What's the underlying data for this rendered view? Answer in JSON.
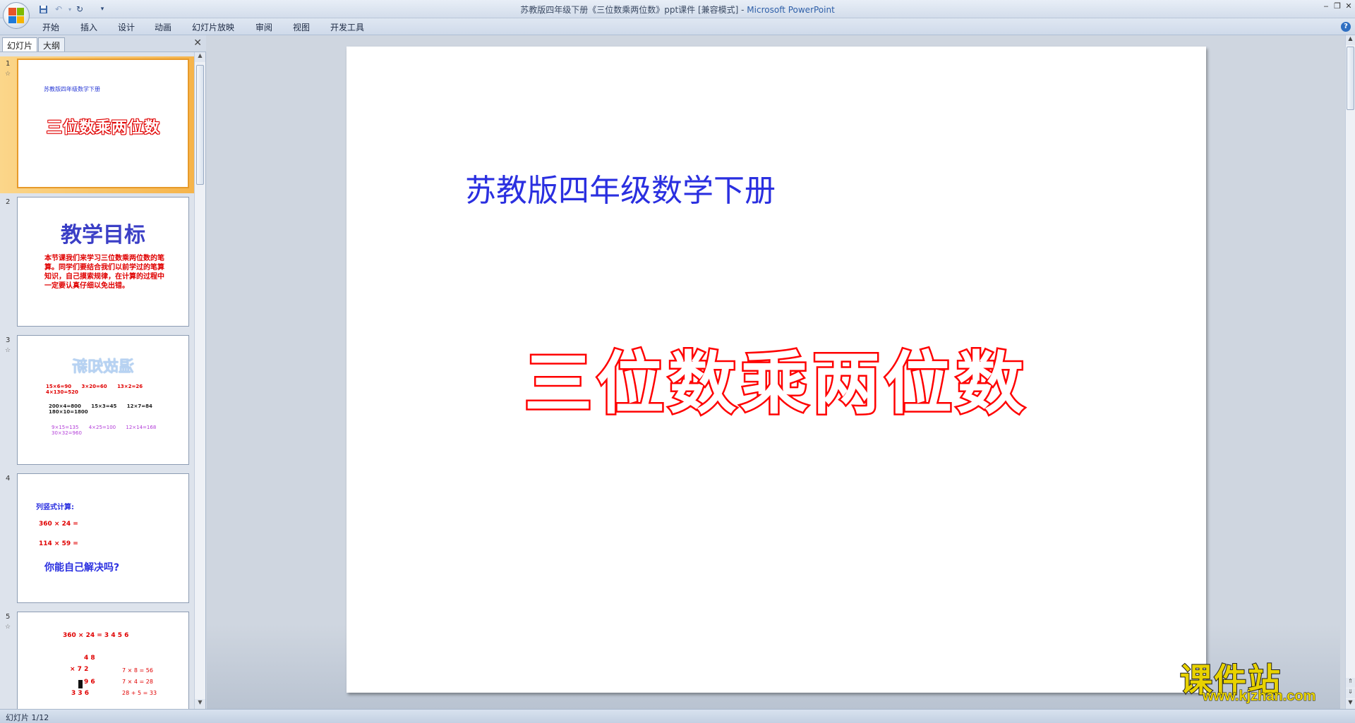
{
  "window": {
    "title": "苏教版四年级下册《三位数乘两位数》ppt课件 [兼容模式] - ",
    "app_name": "Microsoft PowerPoint"
  },
  "ribbon": {
    "tabs": [
      "开始",
      "插入",
      "设计",
      "动画",
      "幻灯片放映",
      "审阅",
      "视图",
      "开发工具"
    ]
  },
  "panel": {
    "tab_slides": "幻灯片",
    "tab_outline": "大纲"
  },
  "thumbnails": [
    {
      "num": "1",
      "subtitle": "苏教版四年级数学下册",
      "title": "三位数乘两位数"
    },
    {
      "num": "2",
      "title": "教学目标",
      "body": "本节课我们来学习三位数乘两位数的笔算。同学们要结合我们以前学过的笔算知识，自己摸索规律，在计算的过程中一定要认真仔细以免出错。"
    },
    {
      "num": "3",
      "title": "温故知新",
      "row1": [
        "15×6=90",
        "3×20=60",
        "13×2=26",
        "4×130=520"
      ],
      "row2": [
        "200×4=800",
        "15×3=45",
        "12×7=84",
        "180×10=1800"
      ],
      "row3": [
        "9×15=135",
        "4×25=100",
        "12×14=168",
        "30×32=960"
      ]
    },
    {
      "num": "4",
      "heading": "列竖式计算:",
      "line1": "360 × 24 =",
      "line2": "114 × 59 =",
      "question": "你能自己解决吗?"
    },
    {
      "num": "5",
      "line1": "360 × 24 = 3 4 5 6",
      "v1": "4 8",
      "v2": "×  7 2",
      "v3": "9 6",
      "v4": "3 3 6",
      "r1": "7 × 8 = 56",
      "r2": "7 × 4 = 28",
      "r3": "28 + 5 = 33"
    }
  ],
  "slide": {
    "subtitle": "苏教版四年级数学下册",
    "title": "三位数乘两位数"
  },
  "status": {
    "text": "幻灯片 1/12"
  },
  "watermark": {
    "cn": "课件站",
    "url": "www.kjzhan.com"
  },
  "colors": {
    "title_stroke": "#ff0000",
    "subtitle_text": "#2a2fe0",
    "selection": "#f6b44a"
  }
}
